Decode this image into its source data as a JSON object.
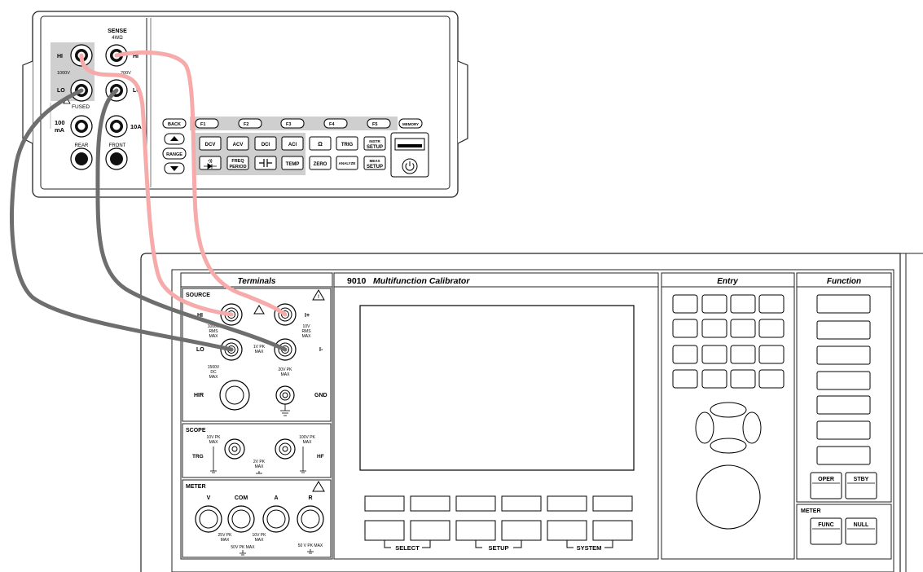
{
  "dmm": {
    "sense_label": "SENSE",
    "sense_4w": "4WΩ",
    "hi_left": "HI",
    "hi_right": "HI",
    "lo_left": "LO",
    "lo_right": "LO",
    "v1000": "1000V",
    "v200": "200V",
    "fused": "FUSED",
    "ma100": "100\nmA",
    "ma100_a": "100",
    "ma100_b": "mA",
    "a10": "10A",
    "rear": "REAR",
    "front": "FRONT",
    "back": "BACK",
    "range": "RANGE",
    "softkeys": [
      "F1",
      "F2",
      "F3",
      "F4",
      "F5"
    ],
    "memory": "MEMORY",
    "row1": [
      "DCV",
      "ACV",
      "DCI",
      "ACI",
      "Ω",
      "TRIG"
    ],
    "instr_setup": [
      "INSTR",
      "SETUP"
    ],
    "freq_period": [
      "FREQ",
      "PERIOD"
    ],
    "temp": "TEMP",
    "zero": "ZERO",
    "analyze": "ANALYZE",
    "meas_setup": [
      "MEAS",
      "SETUP"
    ]
  },
  "calibrator": {
    "title_model": "9010",
    "title_text": "Multifunction Calibrator",
    "terminals_header": "Terminals",
    "entry_header": "Entry",
    "function_header": "Function",
    "source_label": "SOURCE",
    "hi": "HI",
    "lo": "LO",
    "iplus": "I+",
    "iminus": "I-",
    "hir": "HIR",
    "gnd": "GND",
    "src_notes": {
      "hi_max": [
        "1000V",
        "RMS",
        "MAX"
      ],
      "iplus_max": [
        "10V",
        "RMS",
        "MAX"
      ],
      "lo_pk": [
        "1V PK",
        "MAX"
      ],
      "lo_dc": [
        "1500V",
        "DC",
        "MAX"
      ],
      "iminus_pk": [
        "20V PK",
        "MAX"
      ]
    },
    "scope_label": "SCOPE",
    "trg": "TRG",
    "hf": "HF",
    "scope_notes": {
      "trg_max": [
        "10V PK",
        "MAX"
      ],
      "hf_max": [
        "100V PK",
        "MAX"
      ],
      "mid_max": [
        "2V PK",
        "MAX"
      ]
    },
    "meter_label": "METER",
    "meter_terms": [
      "V",
      "COM",
      "A",
      "R"
    ],
    "meter_notes": {
      "v_com": [
        "25V PK",
        "MAX"
      ],
      "com_a": [
        "10V PK",
        "MAX"
      ],
      "gnd": "50V PK MAX",
      "r": "50 V PK MAX"
    },
    "select": "SELECT",
    "setup": "SETUP",
    "system": "SYSTEM",
    "oper": "OPER",
    "stby": "STBY",
    "meter_fn_label": "METER",
    "func": "FUNC",
    "null": "NULL"
  }
}
